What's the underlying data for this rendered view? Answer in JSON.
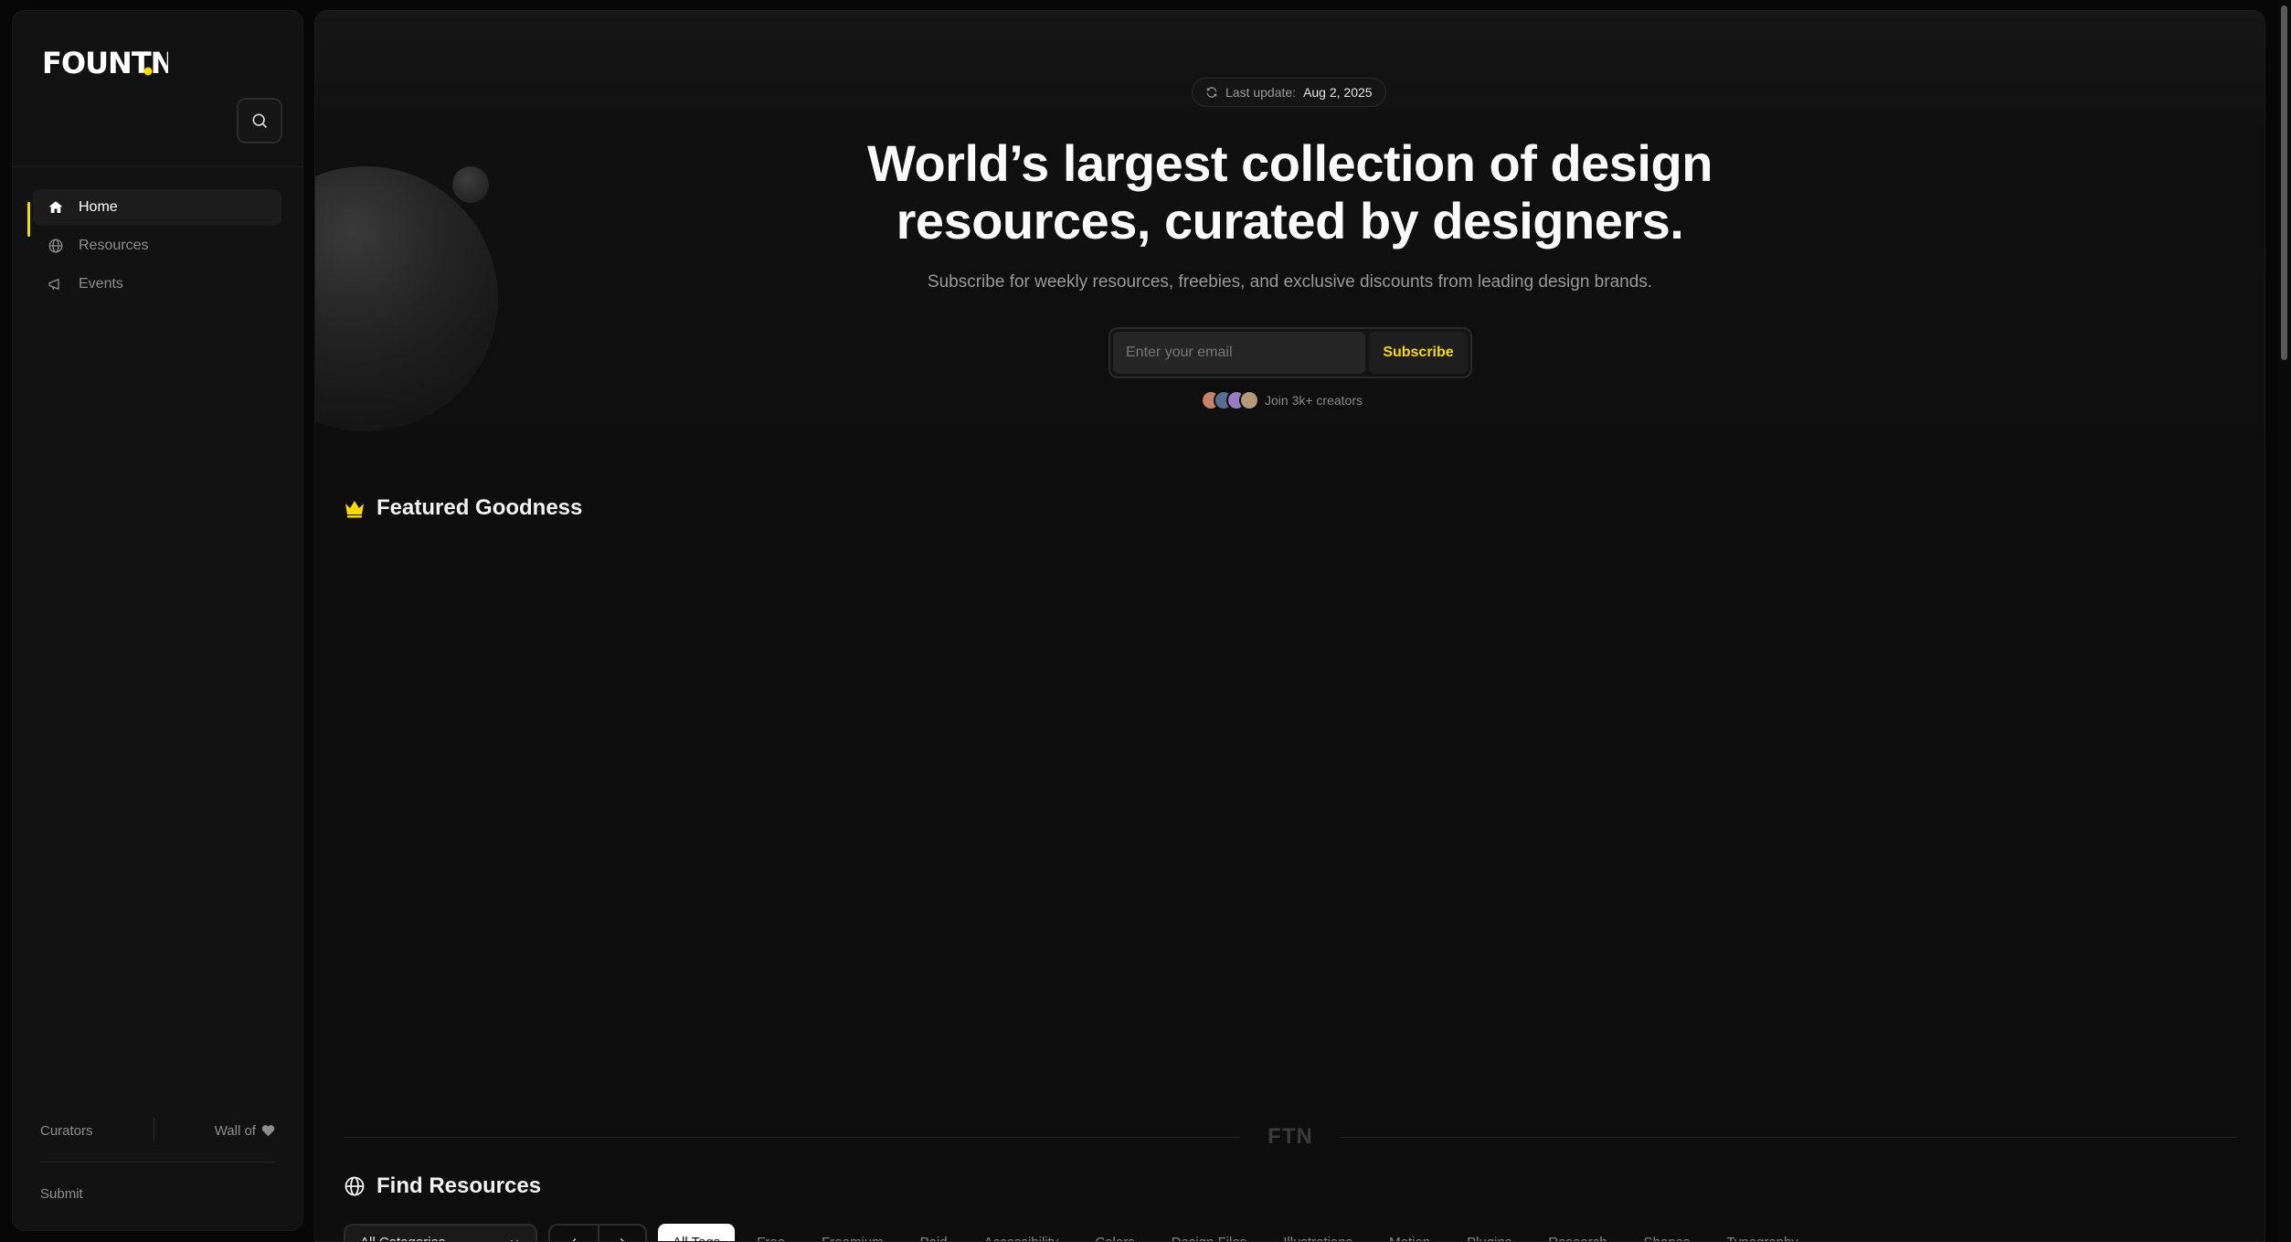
{
  "brand": {
    "name": "FOUNTN",
    "accent_color": "#f5d90a"
  },
  "sidebar": {
    "search_icon": "search-icon",
    "nav": [
      {
        "label": "Home",
        "icon": "home-icon",
        "active": true
      },
      {
        "label": "Resources",
        "icon": "globe-icon",
        "active": false
      },
      {
        "label": "Events",
        "icon": "megaphone-icon",
        "active": false
      }
    ],
    "footer": {
      "curators": "Curators",
      "wall_of": "Wall of",
      "wall_icon": "heart-icon",
      "submit": "Submit"
    }
  },
  "hero": {
    "update_label": "Last update:",
    "update_date": "Aug 2, 2025",
    "title_line1": "World’s largest collection of design",
    "title_line2": "resources, curated by designers.",
    "subtitle": "Subscribe for weekly resources, freebies, and exclusive discounts from leading design brands.",
    "email_placeholder": "Enter your email",
    "subscribe_label": "Subscribe",
    "join_text": "Join 3k+ creators"
  },
  "featured": {
    "title": "Featured Goodness",
    "icon": "crown-icon"
  },
  "divider_mark": "FTN",
  "find": {
    "title": "Find Resources",
    "icon": "globe-icon",
    "category_select": "All Categories",
    "tags": [
      "All Tags",
      "Free",
      "Freemium",
      "Paid",
      "Accessibility",
      "Colors",
      "Design Files",
      "Illustrations",
      "Motion",
      "Plugins",
      "Research",
      "Shapes",
      "Typography"
    ]
  }
}
